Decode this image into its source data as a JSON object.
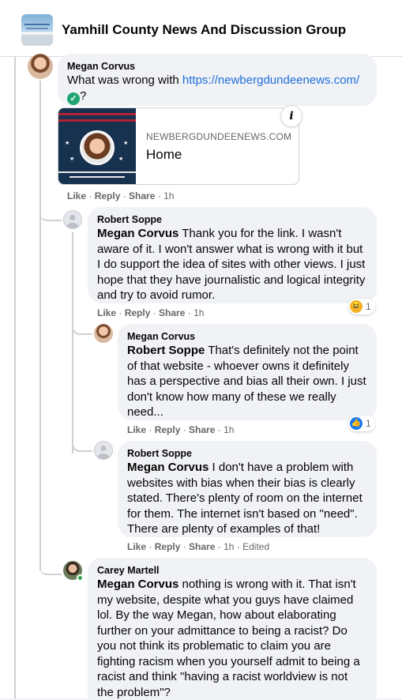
{
  "header": {
    "group_name": "Yamhill County News And Discussion Group"
  },
  "comments": [
    {
      "author": "Megan Corvus",
      "text_prefix": "What was wrong with ",
      "link": "https://newbergdundeenews.com/",
      "text_suffix": "?",
      "preview": {
        "domain": "NEWBERGDUNDEENEWS.COM",
        "title": "Home"
      },
      "actions": {
        "like": "Like",
        "reply": "Reply",
        "share": "Share",
        "time": "1h"
      }
    },
    {
      "author": "Robert Soppe",
      "mention": "Megan Corvus",
      "text": " Thank you for the link. I wasn't aware of it. I won't answer what is wrong with it but I do support the idea of sites with other views. I just hope that they have journalistic and logical integrity and try to avoid rumor.",
      "reaction": {
        "type": "haha",
        "count": "1"
      },
      "actions": {
        "like": "Like",
        "reply": "Reply",
        "share": "Share",
        "time": "1h"
      }
    },
    {
      "author": "Megan Corvus",
      "mention": "Robert Soppe",
      "text": " That's definitely not the point of that website - whoever owns it definitely has a perspective and bias all their own. I just don't know how many of these we really need...",
      "reaction": {
        "type": "like",
        "count": "1"
      },
      "actions": {
        "like": "Like",
        "reply": "Reply",
        "share": "Share",
        "time": "1h"
      }
    },
    {
      "author": "Robert Soppe",
      "mention": "Megan Corvus",
      "text": " I don't have a problem with websites with bias when their bias is clearly stated. There's plenty of room on the internet for them. The internet isn't based on \"need\". There are plenty of examples of that!",
      "actions": {
        "like": "Like",
        "reply": "Reply",
        "share": "Share",
        "time": "1h",
        "edited": "Edited"
      }
    },
    {
      "author": "Carey Martell",
      "mention": "Megan Corvus",
      "text": " nothing is wrong with it. That isn't my website, despite what you guys have claimed lol. By the way Megan, how about elaborating further on your admittance to being a racist? Do you not think its problematic to claim you are fighting racism when you yourself admit to being a racist and think \"having a racist worldview is not the problem\"?"
    }
  ],
  "icons": {
    "verified": "check-badge-icon",
    "info": "info-icon",
    "haha": "haha-reaction-icon",
    "like": "like-reaction-icon"
  },
  "colors": {
    "link": "#216fdb",
    "bubble": "#f0f2f5",
    "online": "#31a24c"
  }
}
